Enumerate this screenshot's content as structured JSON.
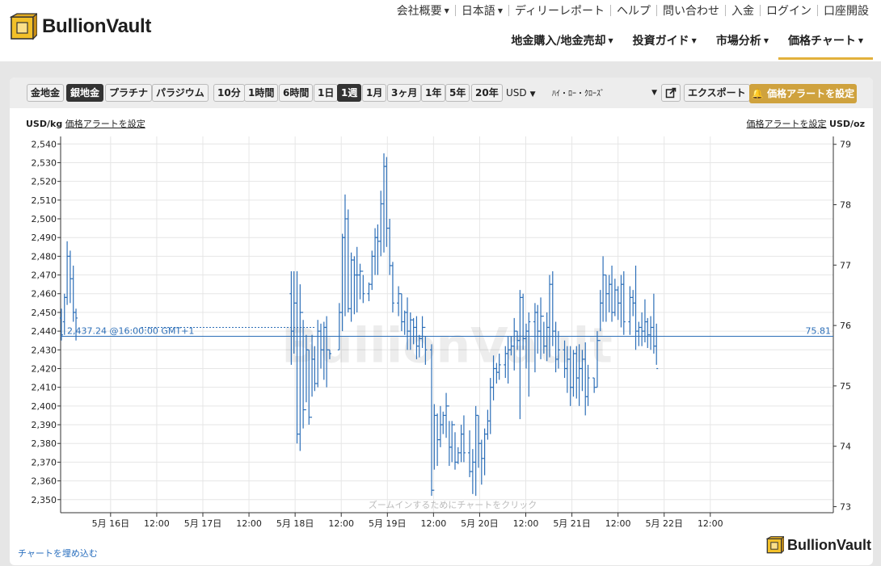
{
  "brand": {
    "name": "BullionVault"
  },
  "topnav": [
    {
      "label": "会社概要",
      "caret": true
    },
    {
      "label": "日本語",
      "caret": true
    },
    {
      "label": "ディリーレポート",
      "caret": false
    },
    {
      "label": "ヘルプ",
      "caret": false
    },
    {
      "label": "問い合わせ",
      "caret": false
    },
    {
      "label": "入金",
      "caret": false
    },
    {
      "label": "ログイン",
      "caret": false
    },
    {
      "label": "口座開設",
      "caret": false
    }
  ],
  "mainnav": [
    {
      "label": "地金購入/地金売却",
      "active": false
    },
    {
      "label": "投資ガイド",
      "active": false
    },
    {
      "label": "市場分析",
      "active": false
    },
    {
      "label": "価格チャート",
      "active": true
    }
  ],
  "toolbar": {
    "metals": [
      "金地金",
      "銀地金",
      "プラチナ",
      "パラジウム"
    ],
    "metal_selected": "銀地金",
    "ranges": [
      "10分",
      "1時間",
      "6時間",
      "1日",
      "1週",
      "1月",
      "3ヶ月",
      "1年",
      "5年",
      "20年"
    ],
    "range_selected": "1週",
    "currency": "USD",
    "chart_style": "ﾊｲ・ﾛｰ・ｸﾛｰｽﾞ",
    "export_label": "エクスポート",
    "alert_label": "価格アラートを設定"
  },
  "units": {
    "left": "USD/kg",
    "right": "USD/oz",
    "alert_link": "価格アラートを設定"
  },
  "watermark": "BullionVault",
  "zoom_hint": "ズームインするためにチャートをクリック",
  "embed_link": "チャートを埋め込む",
  "colors": {
    "bars": "#2d6fb8",
    "accent": "#e2b13c",
    "alert_btn": "#cfa23e"
  },
  "chart_data": {
    "type": "ohlc",
    "title": "",
    "ylabel_left": "USD/kg",
    "ylabel_right": "USD/oz",
    "ylim": [
      2343,
      2544
    ],
    "ylim_right": [
      72.9,
      79.13
    ],
    "yticks_left": [
      2350,
      2360,
      2370,
      2380,
      2390,
      2400,
      2410,
      2420,
      2430,
      2440,
      2450,
      2460,
      2470,
      2480,
      2490,
      2500,
      2510,
      2520,
      2530,
      2540
    ],
    "yticks_right": [
      73,
      74,
      75,
      76,
      77,
      78,
      79
    ],
    "xlim_hours": [
      395,
      596
    ],
    "xticks": [
      {
        "hour": 408,
        "label": "5月 16日"
      },
      {
        "hour": 420,
        "label": "12:00"
      },
      {
        "hour": 432,
        "label": "5月 17日"
      },
      {
        "hour": 444,
        "label": "12:00"
      },
      {
        "hour": 456,
        "label": "5月 18日"
      },
      {
        "hour": 468,
        "label": "12:00"
      },
      {
        "hour": 480,
        "label": "5月 19日"
      },
      {
        "hour": 492,
        "label": "12:00"
      },
      {
        "hour": 504,
        "label": "5月 20日"
      },
      {
        "hour": 516,
        "label": "12:00"
      },
      {
        "hour": 528,
        "label": "5月 21日"
      },
      {
        "hour": 540,
        "label": "12:00"
      },
      {
        "hour": 552,
        "label": "5月 22日"
      },
      {
        "hour": 564,
        "label": "12:00"
      }
    ],
    "current": {
      "value": 2437.24,
      "label": "2,437.24 @16:00:00 GMT+1",
      "right_label": "75.81"
    },
    "series": [
      {
        "values": [
          [
            395.2,
            2452,
            2435,
            2447,
            2438
          ],
          [
            396.0,
            2460,
            2438,
            2445,
            2458
          ],
          [
            396.7,
            2488,
            2454,
            2458,
            2480
          ],
          [
            397.5,
            2483,
            2455,
            2480,
            2468
          ],
          [
            398.3,
            2475,
            2445,
            2468,
            2450
          ],
          [
            399.0,
            2452,
            2435,
            2450,
            2447
          ],
          [
            455.0,
            2472,
            2422,
            2460,
            2440
          ],
          [
            455.7,
            2472,
            2428,
            2440,
            2455
          ],
          [
            456.5,
            2472,
            2380,
            2455,
            2385
          ],
          [
            457.3,
            2465,
            2376,
            2385,
            2450
          ],
          [
            458.1,
            2446,
            2388,
            2450,
            2398
          ],
          [
            458.9,
            2438,
            2402,
            2398,
            2430
          ],
          [
            459.6,
            2430,
            2390,
            2430,
            2394
          ],
          [
            460.4,
            2438,
            2405,
            2394,
            2425
          ],
          [
            461.1,
            2432,
            2408,
            2425,
            2412
          ],
          [
            461.9,
            2446,
            2410,
            2412,
            2440
          ],
          [
            462.7,
            2444,
            2420,
            2440,
            2430
          ],
          [
            463.5,
            2445,
            2414,
            2430,
            2442
          ],
          [
            464.2,
            2448,
            2410,
            2442,
            2430
          ],
          [
            465.0,
            2430,
            2425,
            2430,
            2428
          ],
          [
            467.5,
            2455,
            2430,
            2430,
            2450
          ],
          [
            468.3,
            2492,
            2440,
            2450,
            2490
          ],
          [
            469.0,
            2513,
            2448,
            2490,
            2500
          ],
          [
            469.8,
            2505,
            2450,
            2500,
            2452
          ],
          [
            470.6,
            2482,
            2445,
            2452,
            2478
          ],
          [
            471.4,
            2480,
            2449,
            2478,
            2470
          ],
          [
            472.1,
            2485,
            2450,
            2470,
            2470
          ],
          [
            472.9,
            2476,
            2457,
            2470,
            2472
          ],
          [
            473.7,
            2470,
            2455,
            2472,
            2460
          ],
          [
            475.2,
            2466,
            2456,
            2460,
            2465
          ],
          [
            476.0,
            2483,
            2462,
            2465,
            2480
          ],
          [
            476.8,
            2495,
            2470,
            2480,
            2490
          ],
          [
            477.5,
            2497,
            2470,
            2490,
            2488
          ],
          [
            478.3,
            2515,
            2480,
            2488,
            2508
          ],
          [
            479.1,
            2535,
            2482,
            2508,
            2528
          ],
          [
            479.8,
            2533,
            2485,
            2528,
            2495
          ],
          [
            480.6,
            2500,
            2470,
            2495,
            2475
          ],
          [
            481.4,
            2477,
            2450,
            2475,
            2455
          ],
          [
            482.9,
            2464,
            2448,
            2455,
            2460
          ],
          [
            483.7,
            2460,
            2440,
            2460,
            2445
          ],
          [
            484.5,
            2451,
            2438,
            2445,
            2450
          ],
          [
            485.2,
            2458,
            2430,
            2450,
            2440
          ],
          [
            486.0,
            2450,
            2430,
            2440,
            2446
          ],
          [
            486.8,
            2447,
            2433,
            2446,
            2442
          ],
          [
            487.6,
            2448,
            2425,
            2442,
            2432
          ],
          [
            488.3,
            2438,
            2426,
            2432,
            2436
          ],
          [
            489.1,
            2448,
            2431,
            2436,
            2442
          ],
          [
            489.9,
            2437,
            2422,
            2442,
            2430
          ],
          [
            491.5,
            2433,
            2352,
            2430,
            2355
          ],
          [
            492.2,
            2401,
            2366,
            2355,
            2395
          ],
          [
            493.0,
            2396,
            2368,
            2395,
            2382
          ],
          [
            493.8,
            2400,
            2378,
            2382,
            2390
          ],
          [
            494.5,
            2397,
            2385,
            2390,
            2395
          ],
          [
            495.3,
            2407,
            2383,
            2395,
            2400
          ],
          [
            496.1,
            2392,
            2368,
            2400,
            2378
          ],
          [
            496.8,
            2392,
            2370,
            2378,
            2390
          ],
          [
            497.6,
            2386,
            2366,
            2390,
            2370
          ],
          [
            498.4,
            2378,
            2369,
            2370,
            2375
          ],
          [
            499.2,
            2390,
            2370,
            2375,
            2385
          ],
          [
            499.9,
            2395,
            2370,
            2385,
            2375
          ],
          [
            501.4,
            2387,
            2362,
            2375,
            2365
          ],
          [
            502.2,
            2377,
            2353,
            2365,
            2370
          ],
          [
            503.0,
            2400,
            2352,
            2370,
            2395
          ],
          [
            503.7,
            2395,
            2367,
            2395,
            2380
          ],
          [
            504.5,
            2382,
            2358,
            2380,
            2372
          ],
          [
            505.3,
            2388,
            2363,
            2372,
            2385
          ],
          [
            506.1,
            2398,
            2382,
            2385,
            2392
          ],
          [
            506.8,
            2415,
            2385,
            2392,
            2410
          ],
          [
            507.6,
            2427,
            2403,
            2410,
            2420
          ],
          [
            508.4,
            2423,
            2412,
            2420,
            2418
          ],
          [
            509.1,
            2428,
            2414,
            2418,
            2422
          ],
          [
            510.7,
            2432,
            2415,
            2422,
            2428
          ],
          [
            511.4,
            2437,
            2412,
            2428,
            2430
          ],
          [
            512.2,
            2437,
            2427,
            2430,
            2432
          ],
          [
            513.0,
            2447,
            2419,
            2432,
            2440
          ],
          [
            513.8,
            2440,
            2430,
            2440,
            2435
          ],
          [
            514.5,
            2462,
            2393,
            2435,
            2458
          ],
          [
            515.3,
            2460,
            2430,
            2458,
            2436
          ],
          [
            516.1,
            2444,
            2420,
            2436,
            2440
          ],
          [
            516.8,
            2450,
            2405,
            2440,
            2445
          ],
          [
            518.4,
            2455,
            2418,
            2445,
            2450
          ],
          [
            519.1,
            2454,
            2428,
            2450,
            2440
          ],
          [
            519.9,
            2458,
            2425,
            2440,
            2448
          ],
          [
            520.7,
            2445,
            2428,
            2448,
            2432
          ],
          [
            521.5,
            2450,
            2424,
            2432,
            2442
          ],
          [
            522.2,
            2470,
            2426,
            2442,
            2465
          ],
          [
            523.0,
            2472,
            2432,
            2465,
            2440
          ],
          [
            523.8,
            2445,
            2418,
            2440,
            2425
          ],
          [
            524.5,
            2440,
            2420,
            2425,
            2430
          ],
          [
            526.1,
            2435,
            2415,
            2430,
            2420
          ],
          [
            526.8,
            2432,
            2407,
            2420,
            2425
          ],
          [
            527.6,
            2432,
            2400,
            2425,
            2410
          ],
          [
            528.4,
            2430,
            2405,
            2410,
            2428
          ],
          [
            529.2,
            2432,
            2404,
            2428,
            2415
          ],
          [
            529.9,
            2433,
            2400,
            2415,
            2420
          ],
          [
            530.7,
            2430,
            2408,
            2420,
            2425
          ],
          [
            531.5,
            2434,
            2395,
            2425,
            2405
          ],
          [
            532.2,
            2422,
            2400,
            2405,
            2415
          ],
          [
            533.8,
            2415,
            2407,
            2415,
            2410
          ],
          [
            534.6,
            2440,
            2410,
            2410,
            2435
          ],
          [
            535.4,
            2462,
            2440,
            2435,
            2455
          ],
          [
            536.1,
            2480,
            2445,
            2455,
            2470
          ],
          [
            536.9,
            2470,
            2445,
            2470,
            2460
          ],
          [
            537.7,
            2470,
            2450,
            2460,
            2465
          ],
          [
            538.4,
            2475,
            2445,
            2465,
            2450
          ],
          [
            539.2,
            2468,
            2448,
            2450,
            2462
          ],
          [
            540.0,
            2464,
            2446,
            2462,
            2455
          ],
          [
            540.8,
            2470,
            2442,
            2455,
            2465
          ],
          [
            541.5,
            2472,
            2438,
            2465,
            2445
          ],
          [
            543.1,
            2464,
            2438,
            2445,
            2458
          ],
          [
            543.9,
            2462,
            2448,
            2458,
            2455
          ],
          [
            544.6,
            2475,
            2430,
            2455,
            2440
          ],
          [
            545.4,
            2445,
            2432,
            2440,
            2442
          ],
          [
            546.2,
            2450,
            2432,
            2442,
            2440
          ],
          [
            547.0,
            2457,
            2434,
            2440,
            2445
          ],
          [
            547.7,
            2447,
            2431,
            2445,
            2438
          ],
          [
            548.5,
            2448,
            2430,
            2438,
            2442
          ],
          [
            549.3,
            2460,
            2428,
            2442,
            2432
          ],
          [
            550.0,
            2444,
            2422,
            2432,
            2420
          ]
        ]
      }
    ]
  }
}
